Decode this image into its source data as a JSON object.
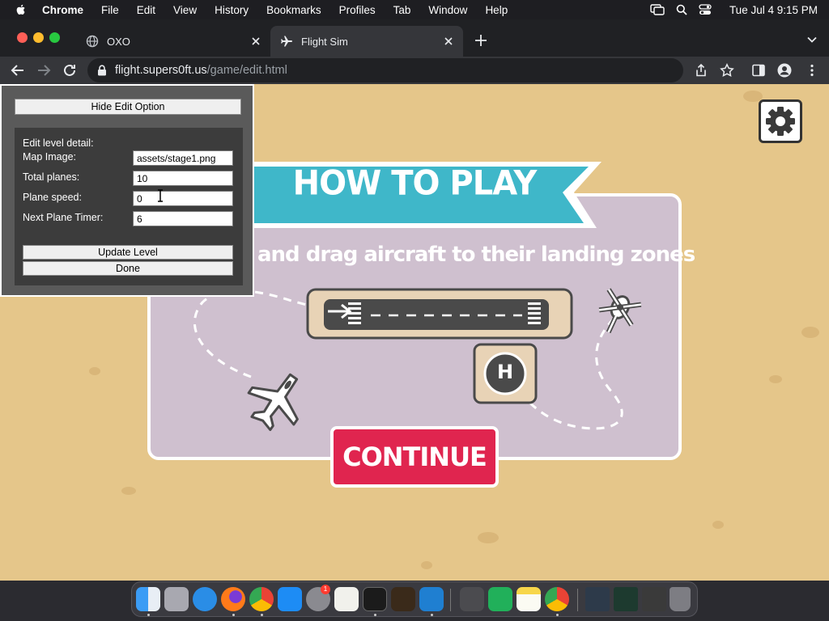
{
  "menubar": {
    "app": "Chrome",
    "items": [
      "File",
      "Edit",
      "View",
      "History",
      "Bookmarks",
      "Profiles",
      "Tab",
      "Window",
      "Help"
    ],
    "clock": "Tue Jul 4  9:15 PM"
  },
  "tabs": [
    {
      "title": "OXO",
      "active": false
    },
    {
      "title": "Flight Sim",
      "active": true
    }
  ],
  "omnibox": {
    "host": "flight.supers0ft.us",
    "path": "/game/edit.html"
  },
  "game": {
    "title": "HOW TO PLAY",
    "instruction": "and drag aircraft to their landing zones",
    "continue_label": "CONTINUE",
    "helipad_letter": "H"
  },
  "edit_panel": {
    "hide_button": "Hide Edit Option",
    "heading": "Edit level detail:",
    "fields": [
      {
        "label": "Map Image:",
        "value": "assets/stage1.png"
      },
      {
        "label": "Total planes:",
        "value": "10"
      },
      {
        "label": "Plane speed:",
        "value": "0"
      },
      {
        "label": "Next Plane Timer:",
        "value": "6"
      }
    ],
    "update_button": "Update Level",
    "done_button": "Done"
  },
  "colors": {
    "sand": "#e5c68a",
    "panel": "#cfc0cf",
    "banner": "#3fb7c9",
    "continue": "#e0254f",
    "runway": "#4a4a4a"
  },
  "dock": {
    "badge": "1"
  }
}
